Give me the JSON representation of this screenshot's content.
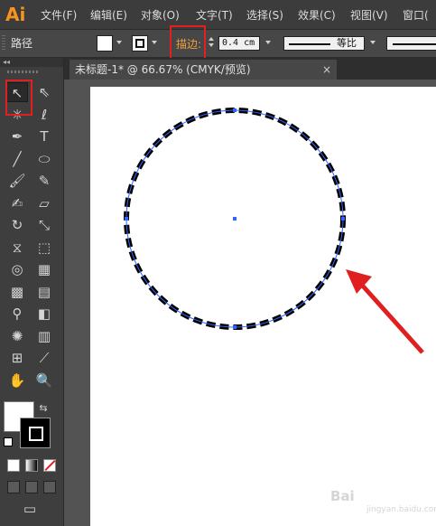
{
  "app": {
    "logo": "Ai"
  },
  "menu": [
    "文件(F)",
    "编辑(E)",
    "对象(O)",
    "文字(T)",
    "选择(S)",
    "效果(C)",
    "视图(V)",
    "窗口("
  ],
  "control_bar": {
    "selection_label": "路径",
    "stroke_label": "描边:",
    "stroke_weight": "0.4 cm",
    "profile_label": "等比",
    "fill_color": "#ffffff",
    "stroke_color": "#000000"
  },
  "document_tab": {
    "title": "未标题-1* @ 66.67% (CMYK/预览)",
    "close_glyph": "×"
  },
  "toolbox": {
    "collapse_glyph": "◂◂",
    "tools": [
      {
        "name": "selection-tool",
        "glyph": "↖"
      },
      {
        "name": "direct-selection-tool",
        "glyph": "⇖"
      },
      {
        "name": "magic-wand-tool",
        "glyph": "✳"
      },
      {
        "name": "lasso-tool",
        "glyph": "ℓ"
      },
      {
        "name": "pen-tool",
        "glyph": "✒"
      },
      {
        "name": "type-tool",
        "glyph": "T"
      },
      {
        "name": "line-tool",
        "glyph": "╱"
      },
      {
        "name": "ellipse-tool",
        "glyph": "⬭"
      },
      {
        "name": "paintbrush-tool",
        "glyph": "🖌"
      },
      {
        "name": "pencil-tool",
        "glyph": "✎"
      },
      {
        "name": "blob-brush-tool",
        "glyph": "✍"
      },
      {
        "name": "eraser-tool",
        "glyph": "▱"
      },
      {
        "name": "rotate-tool",
        "glyph": "↻"
      },
      {
        "name": "scale-tool",
        "glyph": "⤡"
      },
      {
        "name": "width-tool",
        "glyph": "⧖"
      },
      {
        "name": "free-transform-tool",
        "glyph": "⬚"
      },
      {
        "name": "shape-builder-tool",
        "glyph": "◎"
      },
      {
        "name": "perspective-grid-tool",
        "glyph": "▦"
      },
      {
        "name": "mesh-tool",
        "glyph": "▩"
      },
      {
        "name": "gradient-tool",
        "glyph": "▤"
      },
      {
        "name": "eyedropper-tool",
        "glyph": "⚲"
      },
      {
        "name": "blend-tool",
        "glyph": "◧"
      },
      {
        "name": "symbol-sprayer-tool",
        "glyph": "✺"
      },
      {
        "name": "column-graph-tool",
        "glyph": "▥"
      },
      {
        "name": "artboard-tool",
        "glyph": "⊞"
      },
      {
        "name": "slice-tool",
        "glyph": "⟋"
      },
      {
        "name": "hand-tool",
        "glyph": "✋"
      },
      {
        "name": "zoom-tool",
        "glyph": "🔍"
      }
    ],
    "swap_glyph": "⇆",
    "screen_mode_glyph": "▭"
  },
  "canvas": {
    "selected_object": "dashed circle",
    "stroke_color": "#000000",
    "selection_color": "#3366ff",
    "annotation_color": "#e02020"
  },
  "watermark": {
    "brand": "Bai",
    "sub": "jingyan.baidu.com"
  }
}
